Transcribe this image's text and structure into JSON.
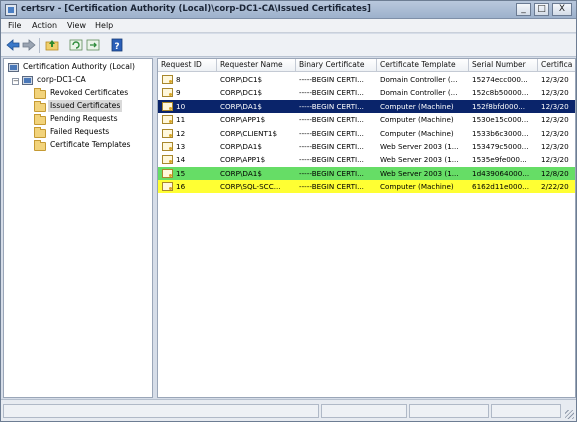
{
  "window": {
    "title": "certsrv - [Certification Authority (Local)\\corp-DC1-CA\\Issued Certificates]",
    "minimize_glyph": "_",
    "maximize_glyph": "□",
    "close_glyph": "X"
  },
  "menu": {
    "items": [
      "File",
      "Action",
      "View",
      "Help"
    ]
  },
  "toolbar": {
    "icons": [
      "back-arrow-icon",
      "forward-arrow-icon",
      "up-folder-icon",
      "refresh-icon",
      "export-icon",
      "help-icon"
    ]
  },
  "tree": {
    "root": "Certification Authority (Local)",
    "ca": "corp-DC1-CA",
    "collapse_glyph": "−",
    "items": [
      "Revoked Certificates",
      "Issued Certificates",
      "Pending Requests",
      "Failed Requests",
      "Certificate Templates"
    ],
    "selected": "Issued Certificates"
  },
  "list": {
    "columns": [
      "Request ID",
      "Requester Name",
      "Binary Certificate",
      "Certificate Template",
      "Serial Number",
      "Certifica"
    ],
    "rows": [
      {
        "id": "8",
        "requester": "CORP\\DC1$",
        "binary": "-----BEGIN CERTI...",
        "template": "Domain Controller (...",
        "serial": "15274ecc000...",
        "date": "12/3/20",
        "highlight": "none"
      },
      {
        "id": "9",
        "requester": "CORP\\DC1$",
        "binary": "-----BEGIN CERTI...",
        "template": "Domain Controller (...",
        "serial": "152c8b50000...",
        "date": "12/3/20",
        "highlight": "none"
      },
      {
        "id": "10",
        "requester": "CORP\\DA1$",
        "binary": "-----BEGIN CERTI...",
        "template": "Computer (Machine)",
        "serial": "152f8bfd000...",
        "date": "12/3/20",
        "highlight": "selected"
      },
      {
        "id": "11",
        "requester": "CORP\\APP1$",
        "binary": "-----BEGIN CERTI...",
        "template": "Computer (Machine)",
        "serial": "1530e15c000...",
        "date": "12/3/20",
        "highlight": "none"
      },
      {
        "id": "12",
        "requester": "CORP\\CLIENT1$",
        "binary": "-----BEGIN CERTI...",
        "template": "Computer (Machine)",
        "serial": "1533b6c3000...",
        "date": "12/3/20",
        "highlight": "none"
      },
      {
        "id": "13",
        "requester": "CORP\\DA1$",
        "binary": "-----BEGIN CERTI...",
        "template": "Web Server 2003 (1...",
        "serial": "153479c5000...",
        "date": "12/3/20",
        "highlight": "none"
      },
      {
        "id": "14",
        "requester": "CORP\\APP1$",
        "binary": "-----BEGIN CERTI...",
        "template": "Web Server 2003 (1...",
        "serial": "1535e9fe000...",
        "date": "12/3/20",
        "highlight": "none"
      },
      {
        "id": "15",
        "requester": "CORP\\DA1$",
        "binary": "-----BEGIN CERTI...",
        "template": "Web Server 2003 (1...",
        "serial": "1d439064000...",
        "date": "12/8/20",
        "highlight": "green"
      },
      {
        "id": "16",
        "requester": "CORP\\SQL-SCC...",
        "binary": "-----BEGIN CERTI...",
        "template": "Computer (Machine)",
        "serial": "6162d11e000...",
        "date": "2/22/20",
        "highlight": "yellow"
      }
    ]
  },
  "colors": {
    "selected_row": "#0a246a",
    "green_row": "#66dd66",
    "yellow_row": "#ffff33"
  }
}
